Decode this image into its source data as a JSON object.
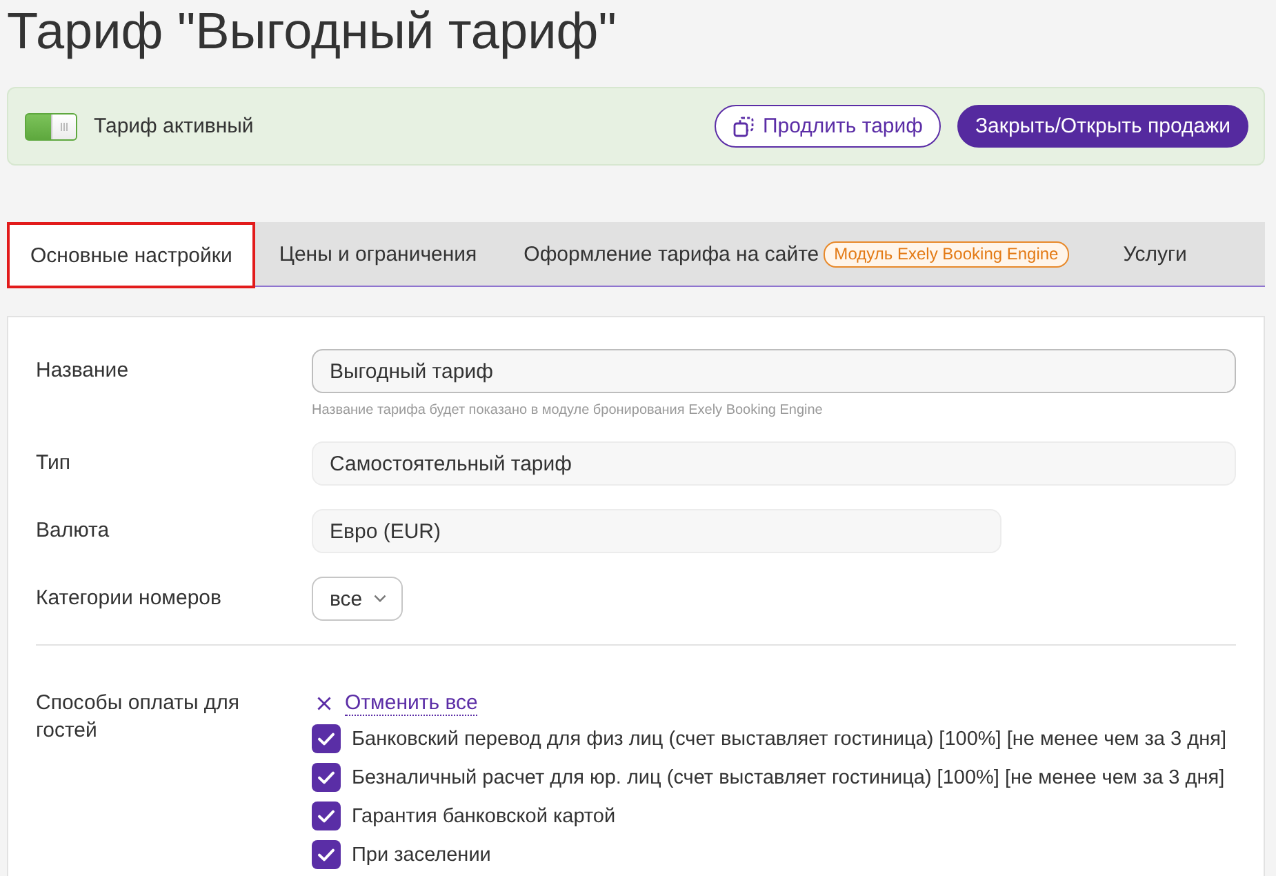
{
  "page": {
    "title": "Тариф \"Выгодный тариф\""
  },
  "status_panel": {
    "toggle": {
      "on": true
    },
    "label": "Тариф активный",
    "buttons": [
      {
        "kind": "outline",
        "label": "Продлить тариф"
      },
      {
        "kind": "primary",
        "label": "Закрыть/Открыть продажи"
      }
    ]
  },
  "tabs": [
    {
      "label": "Основные настройки",
      "selected": true,
      "highlighted": true
    },
    {
      "label": "Цены и ограничения",
      "selected": false,
      "highlighted": false
    },
    {
      "label": "Оформление тарифа на сайте",
      "badge": "Модуль Exely Booking Engine",
      "selected": false,
      "highlighted": false
    },
    {
      "label": "Услуги",
      "selected": false,
      "highlighted": false
    }
  ],
  "form": {
    "fields": [
      {
        "label": "Название",
        "kind": "input",
        "value": "Выгодный тариф",
        "hint": "Название тарифа будет показано в модуле бронирования Exely Booking Engine"
      },
      {
        "label": "Тип",
        "kind": "static",
        "value": "Самостоятельный тариф"
      },
      {
        "label": "Валюта",
        "kind": "static-narrow",
        "value": "Евро (EUR)"
      },
      {
        "label": "Категории номеров",
        "kind": "select",
        "value": "все"
      }
    ],
    "payment": {
      "label": "Способы оплаты для гостей",
      "clear_link": "Отменить все",
      "options": [
        {
          "label": "Банковский перевод для физ лиц (счет выставляет гостиница) [100%] [не менее чем за 3 дня]",
          "checked": true
        },
        {
          "label": "Безналичный расчет для юр. лиц (счет выставляет гостиница) [100%] [не менее чем за 3 дня]",
          "checked": true
        },
        {
          "label": "Гарантия банковской картой",
          "checked": true
        },
        {
          "label": "При заселении",
          "checked": true
        }
      ]
    }
  }
}
